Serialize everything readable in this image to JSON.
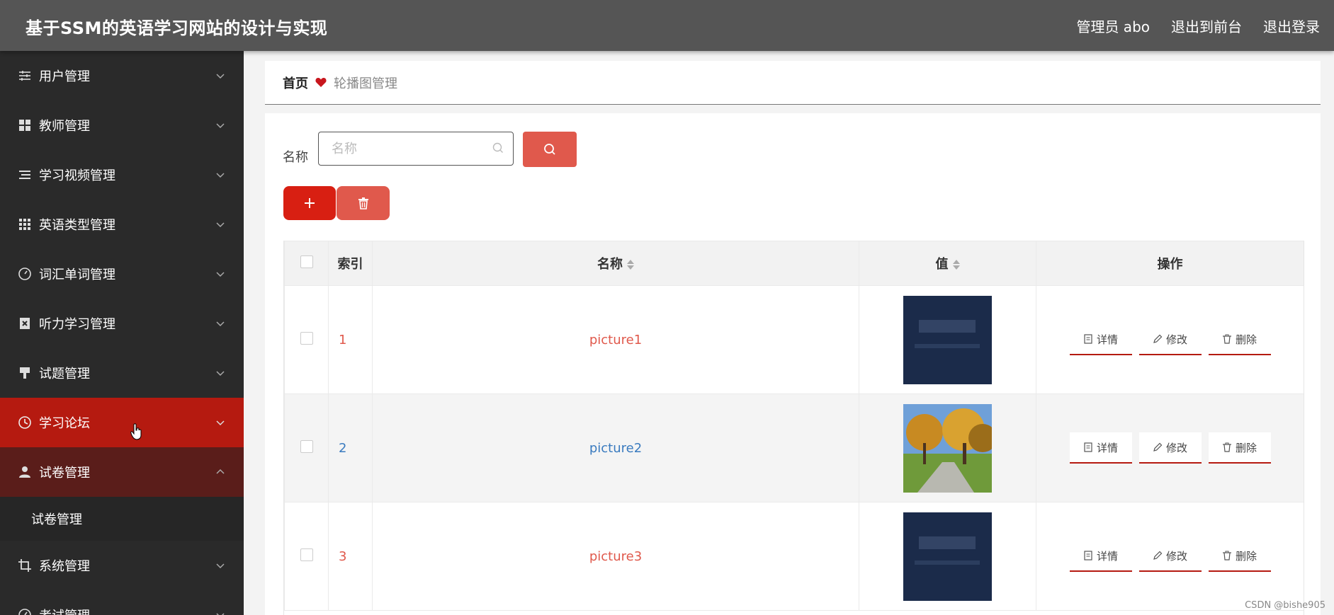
{
  "header": {
    "title": "基于SSM的英语学习网站的设计与实现",
    "user": "管理员 abo",
    "exit_front": "退出到前台",
    "logout": "退出登录"
  },
  "sidebar": {
    "items": [
      {
        "label": "用户管理",
        "icon": "sliders-icon"
      },
      {
        "label": "教师管理",
        "icon": "grid-icon"
      },
      {
        "label": "学习视频管理",
        "icon": "list-icon"
      },
      {
        "label": "英语类型管理",
        "icon": "apps-icon"
      },
      {
        "label": "词汇单词管理",
        "icon": "gauge-icon"
      },
      {
        "label": "听力学习管理",
        "icon": "clipboard-x-icon"
      },
      {
        "label": "试题管理",
        "icon": "brush-icon"
      },
      {
        "label": "学习论坛",
        "icon": "clock-icon"
      },
      {
        "label": "试卷管理",
        "icon": "user-icon"
      },
      {
        "label": "系统管理",
        "icon": "crop-icon"
      },
      {
        "label": "考试管理",
        "icon": "gauge-icon"
      }
    ],
    "sub_item": "试卷管理",
    "active_color": "#b51a10"
  },
  "breadcrumb": {
    "home": "首页",
    "current": "轮播图管理"
  },
  "search": {
    "label": "名称",
    "placeholder": "名称"
  },
  "table": {
    "headers": {
      "index": "索引",
      "name": "名称",
      "value": "值",
      "actions": "操作"
    },
    "rows": [
      {
        "index": "1",
        "name": "picture1",
        "image": "dark-blue-banner"
      },
      {
        "index": "2",
        "name": "picture2",
        "image": "autumn-campus-photo"
      },
      {
        "index": "3",
        "name": "picture3",
        "image": "dark-blue-banner"
      }
    ],
    "actions": {
      "detail": "详情",
      "edit": "修改",
      "delete": "删除"
    }
  },
  "watermark": "CSDN @bishe905",
  "colors": {
    "accent": "#e0594c",
    "primary_red": "#d81f12",
    "link_blue": "#3a7bbf"
  }
}
